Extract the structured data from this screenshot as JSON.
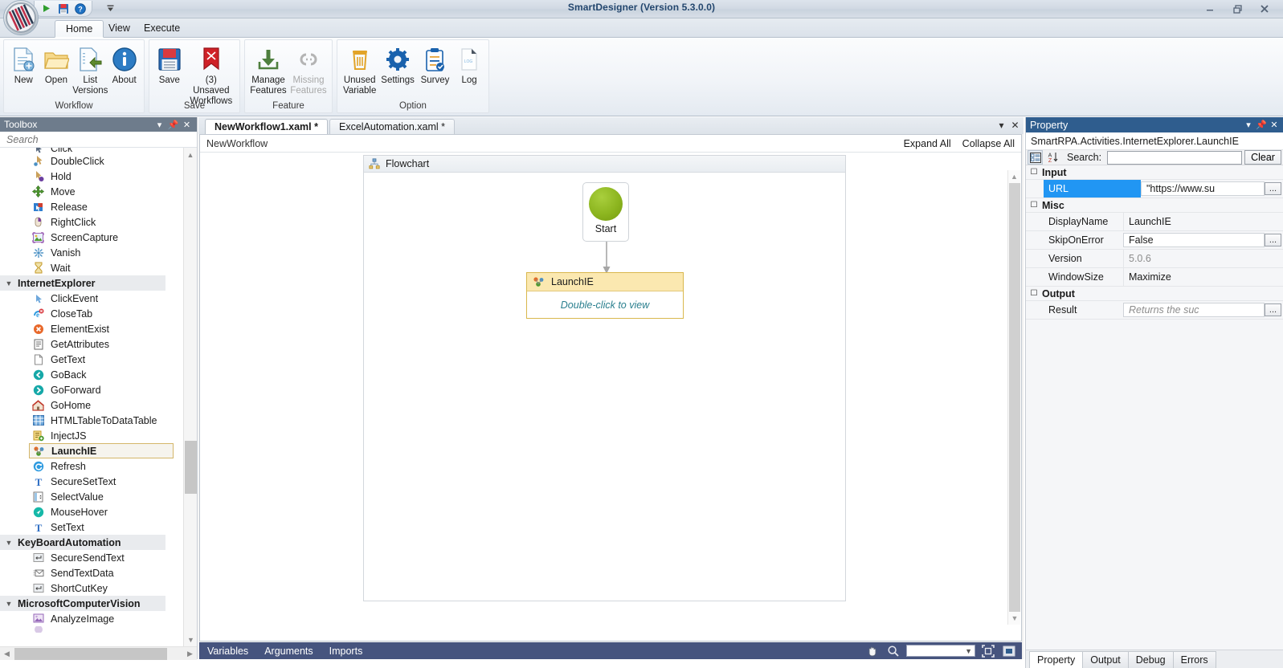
{
  "window": {
    "title": "SmartDesigner (Version 5.3.0.0)",
    "minimize": "–",
    "restore": "❐",
    "close": "✕"
  },
  "quick_access": {
    "run": "run-icon",
    "save": "save-icon",
    "help": "help-icon",
    "customize": "customize-icon"
  },
  "ribbon": {
    "tabs": [
      {
        "label": "Home",
        "active": true
      },
      {
        "label": "View",
        "active": false
      },
      {
        "label": "Execute",
        "active": false
      }
    ],
    "groups": [
      {
        "label": "Workflow",
        "buttons": [
          {
            "label": "New",
            "icon": "new-document-icon",
            "disabled": false
          },
          {
            "label": "Open",
            "icon": "open-folder-icon",
            "disabled": false
          },
          {
            "label": "List Versions",
            "icon": "list-versions-icon",
            "disabled": false
          },
          {
            "label": "About",
            "icon": "about-info-icon",
            "disabled": false
          }
        ]
      },
      {
        "label": "Save",
        "buttons": [
          {
            "label": "Save",
            "icon": "floppy-save-icon",
            "disabled": false
          },
          {
            "label": "(3) Unsaved Workflows",
            "icon": "unsaved-bookmark-icon",
            "disabled": false
          }
        ]
      },
      {
        "label": "Feature",
        "buttons": [
          {
            "label": "Manage Features",
            "icon": "download-feature-icon",
            "disabled": false
          },
          {
            "label": "Missing Features",
            "icon": "broken-link-icon",
            "disabled": true
          }
        ]
      },
      {
        "label": "Option",
        "buttons": [
          {
            "label": "Unused Variable",
            "icon": "trash-icon",
            "disabled": false
          },
          {
            "label": "Settings",
            "icon": "gear-icon",
            "disabled": false
          },
          {
            "label": "Survey",
            "icon": "clipboard-check-icon",
            "disabled": false
          },
          {
            "label": "Log",
            "icon": "log-file-icon",
            "disabled": false
          }
        ]
      }
    ]
  },
  "toolbox": {
    "title": "Toolbox",
    "search_placeholder": "Search",
    "header_icons": [
      "chevron-down-icon",
      "pin-icon",
      "close-icon"
    ],
    "items": [
      {
        "label": "Click",
        "type": "item",
        "icon": "click-icon",
        "clipped": true
      },
      {
        "label": "DoubleClick",
        "type": "item",
        "icon": "double-click-icon"
      },
      {
        "label": "Hold",
        "type": "item",
        "icon": "hold-icon"
      },
      {
        "label": "Move",
        "type": "item",
        "icon": "move-icon"
      },
      {
        "label": "Release",
        "type": "item",
        "icon": "release-icon"
      },
      {
        "label": "RightClick",
        "type": "item",
        "icon": "right-click-icon"
      },
      {
        "label": "ScreenCapture",
        "type": "item",
        "icon": "screen-capture-icon"
      },
      {
        "label": "Vanish",
        "type": "item",
        "icon": "vanish-icon"
      },
      {
        "label": "Wait",
        "type": "item",
        "icon": "hourglass-icon"
      },
      {
        "label": "InternetExplorer",
        "type": "group"
      },
      {
        "label": "ClickEvent",
        "type": "item",
        "icon": "click-event-icon"
      },
      {
        "label": "CloseTab",
        "type": "item",
        "icon": "close-tab-icon"
      },
      {
        "label": "ElementExist",
        "type": "item",
        "icon": "element-exist-icon"
      },
      {
        "label": "GetAttributes",
        "type": "item",
        "icon": "get-attributes-icon"
      },
      {
        "label": "GetText",
        "type": "item",
        "icon": "get-text-icon"
      },
      {
        "label": "GoBack",
        "type": "item",
        "icon": "go-back-icon"
      },
      {
        "label": "GoForward",
        "type": "item",
        "icon": "go-forward-icon"
      },
      {
        "label": "GoHome",
        "type": "item",
        "icon": "go-home-icon"
      },
      {
        "label": "HTMLTableToDataTable",
        "type": "item",
        "icon": "table-icon"
      },
      {
        "label": "InjectJS",
        "type": "item",
        "icon": "inject-js-icon"
      },
      {
        "label": "LaunchIE",
        "type": "item",
        "icon": "launch-ie-icon",
        "selected": true
      },
      {
        "label": "Refresh",
        "type": "item",
        "icon": "refresh-icon"
      },
      {
        "label": "SecureSetText",
        "type": "item",
        "icon": "secure-set-text-icon"
      },
      {
        "label": "SelectValue",
        "type": "item",
        "icon": "select-value-icon"
      },
      {
        "label": "MouseHover",
        "type": "item",
        "icon": "mouse-hover-icon"
      },
      {
        "label": "SetText",
        "type": "item",
        "icon": "set-text-icon"
      },
      {
        "label": "KeyBoardAutomation",
        "type": "group"
      },
      {
        "label": "SecureSendText",
        "type": "item",
        "icon": "secure-send-text-icon"
      },
      {
        "label": "SendTextData",
        "type": "item",
        "icon": "send-text-data-icon"
      },
      {
        "label": "ShortCutKey",
        "type": "item",
        "icon": "shortcut-key-icon"
      },
      {
        "label": "MicrosoftComputerVision",
        "type": "group"
      },
      {
        "label": "AnalyzeImage",
        "type": "item",
        "icon": "analyze-image-icon"
      }
    ]
  },
  "designer": {
    "tabs": [
      {
        "label": "NewWorkflow1.xaml *",
        "active": true
      },
      {
        "label": "ExcelAutomation.xaml *",
        "active": false
      }
    ],
    "tab_controls": [
      "chevron-down-icon",
      "close-icon"
    ],
    "breadcrumb": "NewWorkflow",
    "expand_all": "Expand All",
    "collapse_all": "Collapse All",
    "flowchart": {
      "title": "Flowchart",
      "start_node": {
        "label": "Start"
      },
      "activity_node": {
        "title": "LaunchIE",
        "body": "Double-click to view"
      }
    },
    "statusbar": {
      "items": [
        "Variables",
        "Arguments",
        "Imports"
      ],
      "zoom_value": "",
      "icons": [
        "pan-hand-icon",
        "zoom-magnifier-icon",
        "fit-to-screen-icon",
        "reset-zoom-icon"
      ]
    }
  },
  "property": {
    "title": "Property",
    "header_icons": [
      "chevron-down-icon",
      "pin-icon",
      "close-icon"
    ],
    "type_name": "SmartRPA.Activities.InternetExplorer.LaunchIE",
    "toolbar": {
      "categorized_icon": "categorized-view-icon",
      "sort_icon": "sort-alphabetical-icon",
      "search_label": "Search:",
      "search_value": "",
      "clear_label": "Clear"
    },
    "categories": [
      {
        "name": "Input",
        "rows": [
          {
            "key": "URL",
            "value": "\"https://www.su",
            "selected": true,
            "boxed": true,
            "ellipsis": true
          }
        ]
      },
      {
        "name": "Misc",
        "rows": [
          {
            "key": "DisplayName",
            "value": "LaunchIE",
            "boxed": false,
            "ellipsis": false
          },
          {
            "key": "SkipOnError",
            "value": "False",
            "boxed": true,
            "ellipsis": true
          },
          {
            "key": "Version",
            "value": "5.0.6",
            "readonly": true,
            "boxed": false,
            "ellipsis": false
          },
          {
            "key": "WindowSize",
            "value": "Maximize",
            "boxed": false,
            "ellipsis": false
          }
        ]
      },
      {
        "name": "Output",
        "rows": [
          {
            "key": "Result",
            "value": "Returns the suc",
            "placeholder": true,
            "boxed": true,
            "ellipsis": true
          }
        ]
      }
    ],
    "tabs": [
      {
        "label": "Property",
        "active": true
      },
      {
        "label": "Output",
        "active": false
      },
      {
        "label": "Debug",
        "active": false
      },
      {
        "label": "Errors",
        "active": false
      }
    ]
  },
  "colors": {
    "accent_blue": "#2196f3",
    "property_header": "#2f5d8e",
    "toolbox_header": "#6e7c8c",
    "statusbar": "#46547e",
    "node_yellow": "#fbe8b0",
    "node_border": "#d9b84e",
    "start_green": "#8cb51f",
    "title_blue": "#23466e"
  }
}
